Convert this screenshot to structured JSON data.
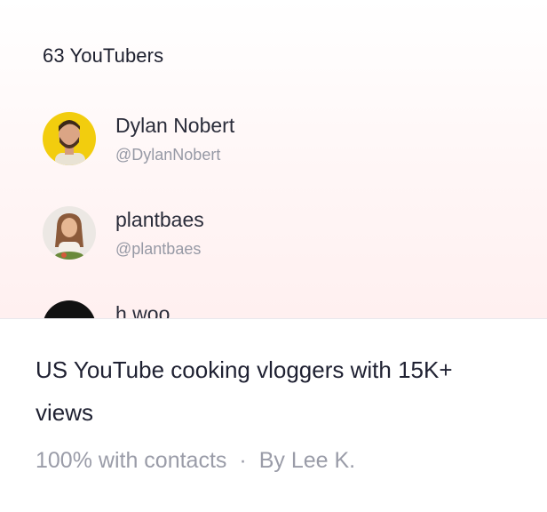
{
  "list": {
    "count_label": "63 YouTubers",
    "items": [
      {
        "name": "Dylan Nobert",
        "handle": "@DylanNobert",
        "avatar_bg": "#f2cd0e"
      },
      {
        "name": "plantbaes",
        "handle": "@plantbaes",
        "avatar_bg": "#ece8e4"
      },
      {
        "name": "h woo",
        "handle": "",
        "avatar_bg": "#111111"
      }
    ]
  },
  "card": {
    "title": "US YouTube cooking vloggers with 15K+ views",
    "contacts": "100% with contacts",
    "separator": "·",
    "author": "By Lee K."
  }
}
